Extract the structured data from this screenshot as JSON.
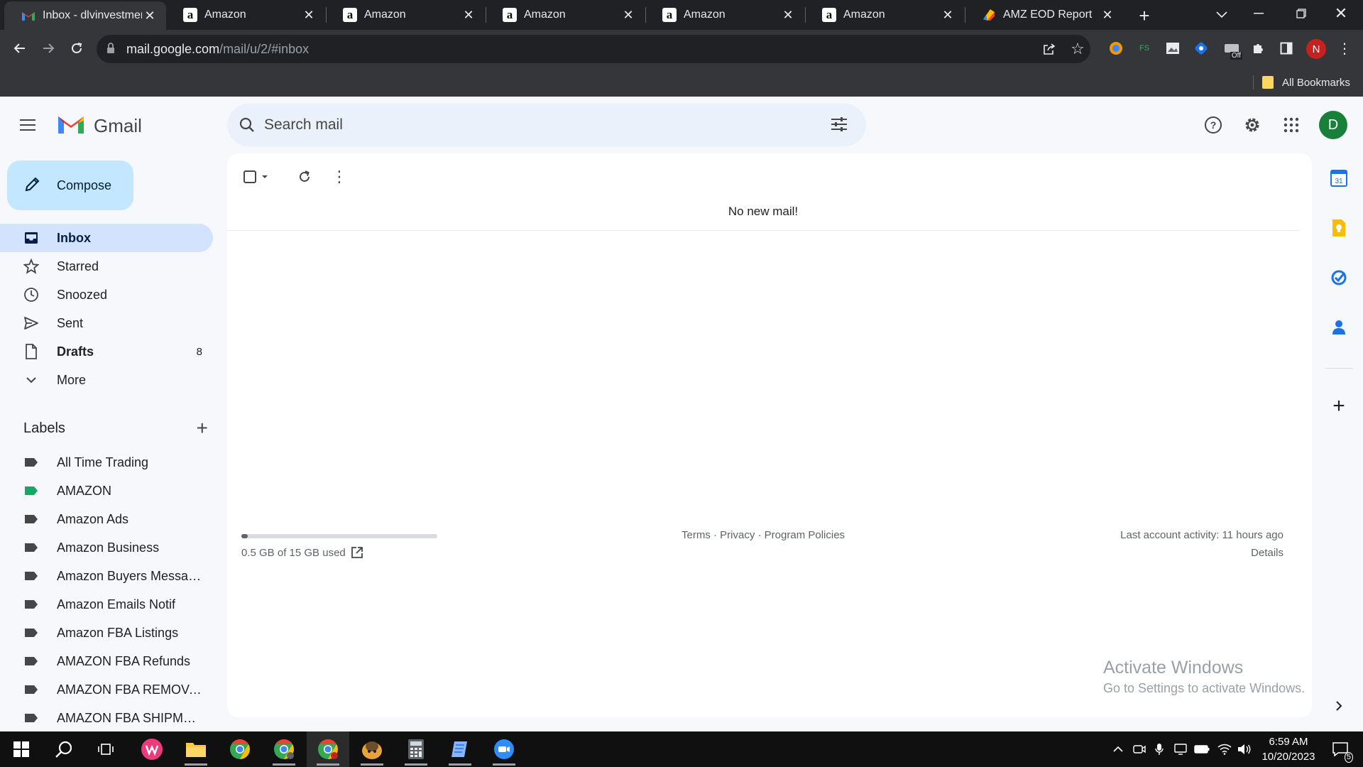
{
  "browser": {
    "tabs": [
      {
        "title": "Inbox - dlvinvestmen",
        "icon": "gmail-icon",
        "active": true
      },
      {
        "title": "Amazon",
        "icon": "amazon-icon",
        "active": false
      },
      {
        "title": "Amazon",
        "icon": "amazon-icon",
        "active": false
      },
      {
        "title": "Amazon",
        "icon": "amazon-icon",
        "active": false
      },
      {
        "title": "Amazon",
        "icon": "amazon-icon",
        "active": false
      },
      {
        "title": "Amazon",
        "icon": "amazon-icon",
        "active": false
      },
      {
        "title": "AMZ EOD Report",
        "icon": "sheets-icon",
        "active": false
      }
    ],
    "url_domain": "mail.google.com",
    "url_path": "/mail/u/2/#inbox",
    "profile_initial": "N",
    "bookmarks_label": "All Bookmarks",
    "extension_off_badge": "Off",
    "extension_fs_label": "FS"
  },
  "gmail": {
    "logo_text": "Gmail",
    "search_placeholder": "Search mail",
    "avatar_initial": "D",
    "compose_label": "Compose",
    "nav": [
      {
        "label": "Inbox",
        "icon": "inbox-icon",
        "active": true
      },
      {
        "label": "Starred",
        "icon": "star-icon"
      },
      {
        "label": "Snoozed",
        "icon": "clock-icon"
      },
      {
        "label": "Sent",
        "icon": "send-icon"
      },
      {
        "label": "Drafts",
        "icon": "draft-icon",
        "count": "8",
        "bold": true
      },
      {
        "label": "More",
        "icon": "chevron-down-icon"
      }
    ],
    "labels_heading": "Labels",
    "labels": [
      {
        "label": "All Time Trading",
        "color": "#444746"
      },
      {
        "label": "AMAZON",
        "color": "#16a765"
      },
      {
        "label": "Amazon Ads",
        "color": "#444746"
      },
      {
        "label": "Amazon Business",
        "color": "#444746"
      },
      {
        "label": "Amazon Buyers Messag...",
        "color": "#444746"
      },
      {
        "label": "Amazon Emails Notif",
        "color": "#444746"
      },
      {
        "label": "Amazon FBA Listings",
        "color": "#444746"
      },
      {
        "label": "AMAZON FBA Refunds",
        "color": "#444746"
      },
      {
        "label": "AMAZON FBA REMOVAL",
        "color": "#444746"
      },
      {
        "label": "AMAZON FBA SHIPMEN...",
        "color": "#444746"
      }
    ],
    "empty_message": "No new mail!",
    "storage_text": "0.5 GB of 15 GB used",
    "storage_fraction": 0.033,
    "footer_links": "Terms · Privacy · Program Policies",
    "last_activity": "Last account activity: 11 hours ago",
    "details_link": "Details",
    "calendar_day": "31"
  },
  "watermark": {
    "line1": "Activate Windows",
    "line2": "Go to Settings to activate Windows."
  },
  "taskbar": {
    "time": "6:59 AM",
    "date": "10/20/2023",
    "notification_count": "5"
  },
  "colors": {
    "gmail_accent": "#0b57d0",
    "compose_bg": "#c2e7ff",
    "active_nav_bg": "#d3e3fd",
    "avatar_bg": "#188038"
  }
}
